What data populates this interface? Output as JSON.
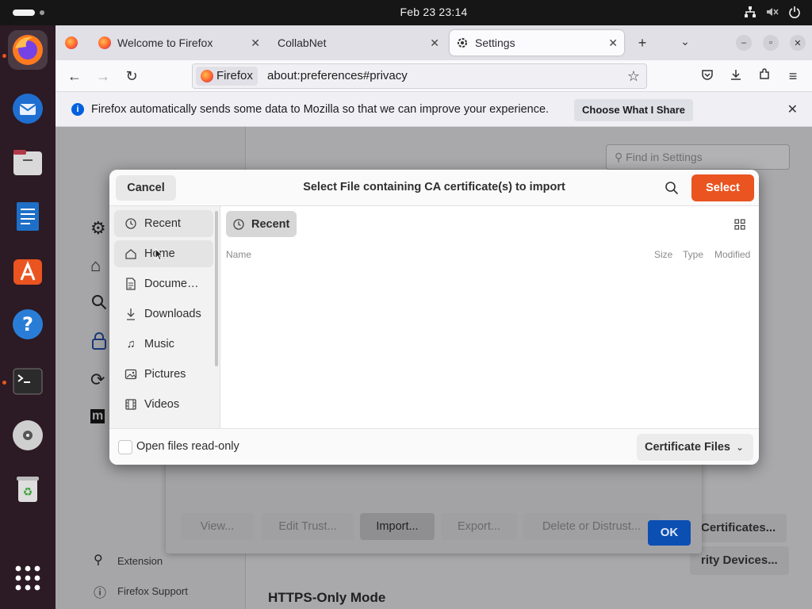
{
  "topbar": {
    "clock": "Feb 23  23:14"
  },
  "dock": {
    "apps": [
      "Firefox",
      "Thunderbird",
      "Files",
      "LibreOffice Writer",
      "App Center",
      "Help",
      "Terminal",
      "Disc",
      "Trash",
      "Show Apps"
    ]
  },
  "browser": {
    "tabs": [
      {
        "label": "Welcome to Firefox"
      },
      {
        "label": "CollabNet"
      },
      {
        "label": "Settings"
      }
    ],
    "urlbar": {
      "identity": "Firefox",
      "url": "about:preferences#privacy"
    },
    "notification": {
      "message": "Firefox automatically sends some data to Mozilla so that we can improve your experience.",
      "button": "Choose What I Share"
    }
  },
  "settings_page": {
    "search_placeholder": "Find in Settings",
    "sidebar_links": [
      "Extension",
      "Firefox Support"
    ],
    "section_title": "HTTPS-Only Mode",
    "right_buttons": [
      "Certificates...",
      "rity Devices..."
    ]
  },
  "certificate_manager": {
    "buttons": [
      "View...",
      "Edit Trust...",
      "Import...",
      "Export...",
      "Delete or Distrust..."
    ],
    "ok": "OK"
  },
  "file_dialog": {
    "cancel": "Cancel",
    "title": "Select File containing CA certificate(s) to import",
    "select": "Select",
    "places": [
      {
        "label": "Recent",
        "icon": "clock-icon"
      },
      {
        "label": "Home",
        "icon": "home-icon"
      },
      {
        "label": "Docume…",
        "icon": "document-icon"
      },
      {
        "label": "Downloads",
        "icon": "download-icon"
      },
      {
        "label": "Music",
        "icon": "music-icon"
      },
      {
        "label": "Pictures",
        "icon": "picture-icon"
      },
      {
        "label": "Videos",
        "icon": "video-icon"
      }
    ],
    "location_chip": "Recent",
    "columns": {
      "name": "Name",
      "size": "Size",
      "type": "Type",
      "modified": "Modified"
    },
    "readonly_label": "Open files read-only",
    "readonly_checked": false,
    "filter": "Certificate Files"
  },
  "colors": {
    "accent": "#e95420",
    "ok_blue": "#0b4fb3",
    "dock_bg": "#2c1a24"
  }
}
